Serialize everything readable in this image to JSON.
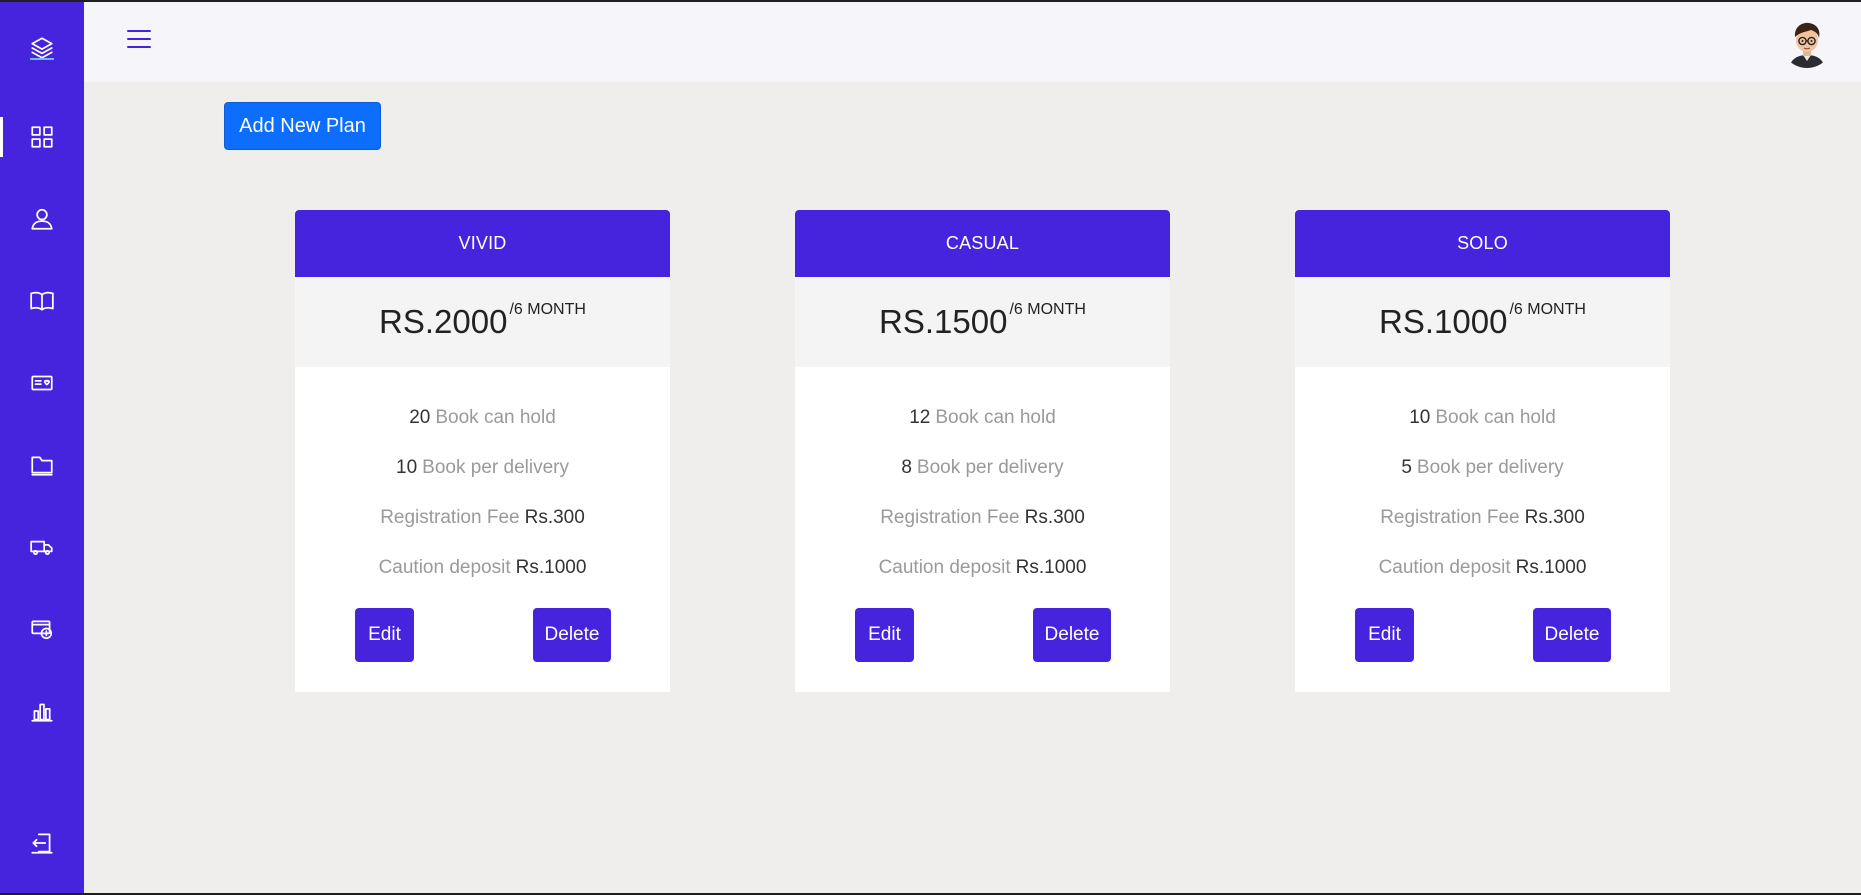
{
  "header": {
    "menu_icon": "hamburger-icon",
    "avatar_icon": "user-avatar"
  },
  "sidebar": {
    "logo_icon": "layers-icon",
    "items": [
      {
        "icon": "dashboard-grid-icon",
        "active": true
      },
      {
        "icon": "user-icon",
        "active": false
      },
      {
        "icon": "book-open-icon",
        "active": false
      },
      {
        "icon": "id-card-icon",
        "active": false
      },
      {
        "icon": "folder-icon",
        "active": false
      },
      {
        "icon": "truck-icon",
        "active": false
      },
      {
        "icon": "payment-icon",
        "active": false
      },
      {
        "icon": "bar-chart-icon",
        "active": false
      }
    ],
    "logout_icon": "logout-icon"
  },
  "toolbar": {
    "add_label": "Add New Plan"
  },
  "colors": {
    "brand": "#4623dc",
    "primary_button": "#0d6efd",
    "page_bg": "#efeeec",
    "topbar_bg": "#f6f6fa"
  },
  "plans": [
    {
      "name": "VIVID",
      "price": "RS.2000",
      "period": "/6 MONTH",
      "hold_count": "20",
      "hold_label": "Book can hold",
      "delivery_count": "10",
      "delivery_label": "Book per delivery",
      "reg_label": "Registration Fee",
      "reg_value": "Rs.300",
      "caution_label": "Caution deposit",
      "caution_value": "Rs.1000",
      "edit_label": "Edit",
      "delete_label": "Delete"
    },
    {
      "name": "CASUAL",
      "price": "RS.1500",
      "period": "/6 MONTH",
      "hold_count": "12",
      "hold_label": "Book can hold",
      "delivery_count": "8",
      "delivery_label": "Book per delivery",
      "reg_label": "Registration Fee",
      "reg_value": "Rs.300",
      "caution_label": "Caution deposit",
      "caution_value": "Rs.1000",
      "edit_label": "Edit",
      "delete_label": "Delete"
    },
    {
      "name": "SOLO",
      "price": "RS.1000",
      "period": "/6 MONTH",
      "hold_count": "10",
      "hold_label": "Book can hold",
      "delivery_count": "5",
      "delivery_label": "Book per delivery",
      "reg_label": "Registration Fee",
      "reg_value": "Rs.300",
      "caution_label": "Caution deposit",
      "caution_value": "Rs.1000",
      "edit_label": "Edit",
      "delete_label": "Delete"
    }
  ]
}
